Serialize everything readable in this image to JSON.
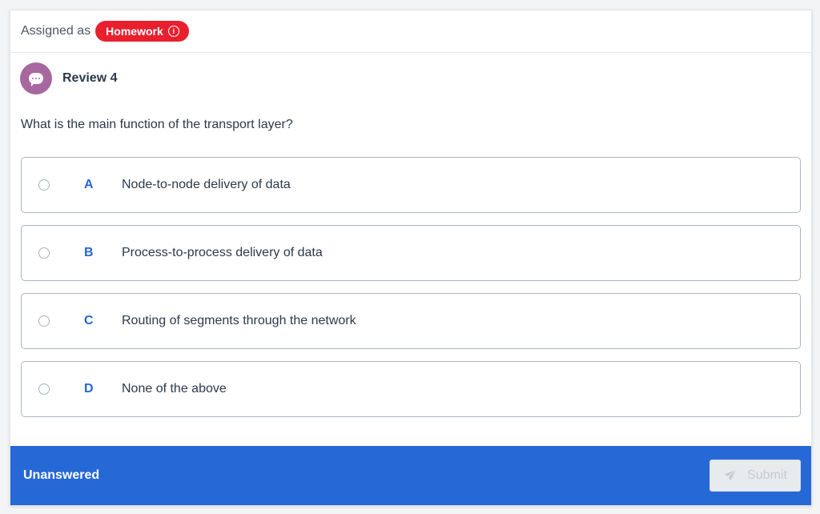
{
  "header": {
    "assigned_label": "Assigned as",
    "badge_label": "Homework",
    "badge_icon": "info-icon",
    "badge_color": "#e8202e"
  },
  "review": {
    "title": "Review 4",
    "icon": "chat-bubble-icon",
    "avatar_color": "#a8679e"
  },
  "question": {
    "text": "What is the main function of the transport layer?",
    "options": [
      {
        "letter": "A",
        "text": "Node-to-node delivery of data",
        "selected": false
      },
      {
        "letter": "B",
        "text": "Process-to-process delivery of data",
        "selected": false
      },
      {
        "letter": "C",
        "text": "Routing of segments through the network",
        "selected": false
      },
      {
        "letter": "D",
        "text": "None of the above",
        "selected": false
      }
    ]
  },
  "footer": {
    "status": "Unanswered",
    "submit_label": "Submit",
    "submit_icon": "send-icon",
    "submit_enabled": false,
    "background_color": "#2668d6"
  }
}
